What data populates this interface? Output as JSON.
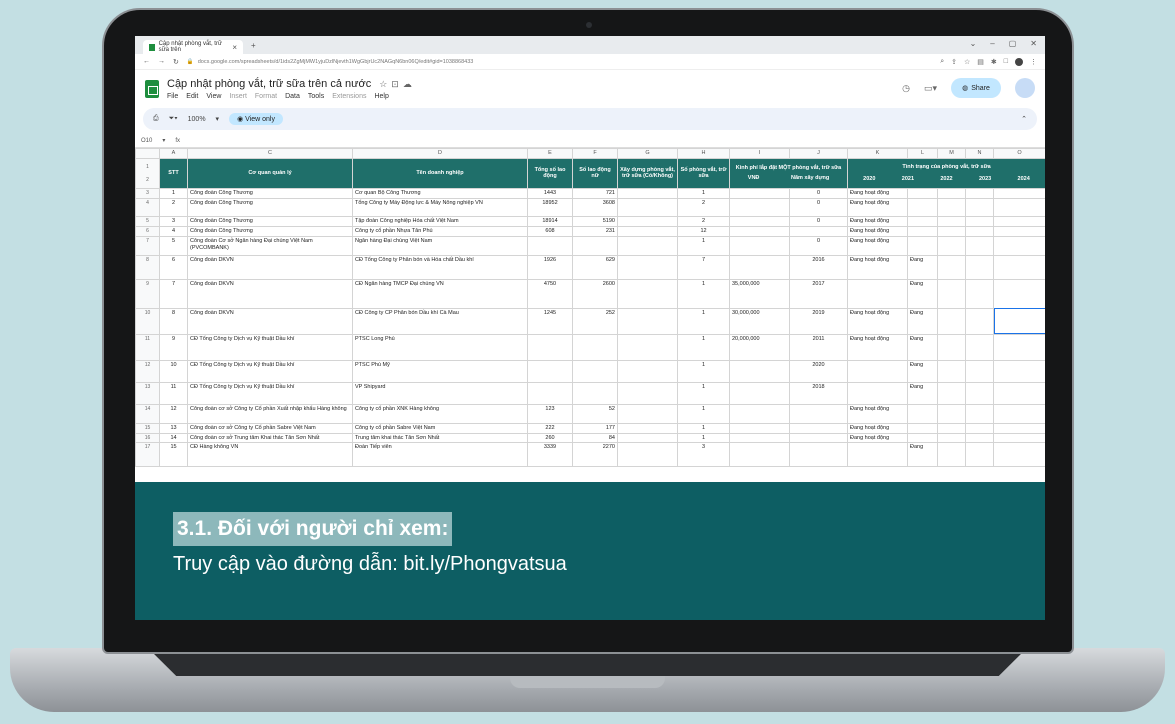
{
  "browser": {
    "tab_title": "Cập nhật phòng vắt, trữ sữa trên",
    "url": "docs.google.com/spreadsheets/d/1ids2ZgMjMW1yjuDzlNjevth1WgGbjrUc2NAGqN6bn06Q/edit#gid=1038868433"
  },
  "doc": {
    "title": "Cập nhật phòng vắt, trữ sữa trên cả nước"
  },
  "menu": {
    "file": "File",
    "edit": "Edit",
    "view": "View",
    "insert": "Insert",
    "format": "Format",
    "data": "Data",
    "tools": "Tools",
    "extensions": "Extensions",
    "help": "Help"
  },
  "header": {
    "share_label": "Share"
  },
  "toolbar": {
    "zoom": "100%",
    "view_only": "View only"
  },
  "formula": {
    "namebox": "O10",
    "fx": "fx"
  },
  "columns": [
    "A",
    "C",
    "D",
    "E",
    "F",
    "G",
    "H",
    "I",
    "J",
    "K",
    "L",
    "M",
    "N",
    "O"
  ],
  "table_header": {
    "stt": "STT",
    "agency": "Cơ quan quản lý",
    "company": "Tên doanh nghiệp",
    "total_workers": "Tổng số lao động",
    "female_workers": "Số lao động nữ",
    "build": "Xây dựng phòng vắt, trữ sữa (Có/Không)",
    "rooms": "Số phòng vắt, trữ sữa",
    "cost": "Kinh phí lắp đặt MỘT phòng vắt, trữ sữa",
    "status": "Tình trạng của phòng vắt, trữ sữa",
    "vnd": "VNĐ",
    "build_year": "Năm xây dựng",
    "y2020": "2020",
    "y2021": "2021",
    "y2022": "2022",
    "y2023": "2023",
    "y2024": "2024"
  },
  "rows": [
    {
      "rn": "3",
      "stt": "1",
      "agency": "Công đoàn Công Thương",
      "company": "Cơ quan Bộ Công Thương",
      "total": "1443",
      "female": "721",
      "build": "",
      "rooms": "1",
      "vnd": "",
      "year": "0",
      "s2020": "Đang hoạt động",
      "s2021": "",
      "rh": 10
    },
    {
      "rn": "4",
      "stt": "2",
      "agency": "Công đoàn Công Thương",
      "company": "Tổng Công ty Máy Động lực & Máy Nông nghiệp VN",
      "total": "18952",
      "female": "3608",
      "build": "",
      "rooms": "2",
      "vnd": "",
      "year": "0",
      "s2020": "Đang hoạt động",
      "s2021": "",
      "rh": 18
    },
    {
      "rn": "5",
      "stt": "3",
      "agency": "Công đoàn Công Thương",
      "company": "Tập đoàn Công nghiệp Hóa chất Việt Nam",
      "total": "18914",
      "female": "5190",
      "build": "",
      "rooms": "2",
      "vnd": "",
      "year": "0",
      "s2020": "Đang hoạt động",
      "s2021": "",
      "rh": 8
    },
    {
      "rn": "6",
      "stt": "4",
      "agency": "Công đoàn Công Thương",
      "company": "Công ty cổ phần Nhựa Tân Phú",
      "total": "608",
      "female": "231",
      "build": "",
      "rooms": "12",
      "vnd": "",
      "year": "",
      "s2020": "Đang hoạt động",
      "s2021": "",
      "rh": 8
    },
    {
      "rn": "7",
      "stt": "5",
      "agency": "Công đoàn Cơ sở Ngân hàng Đại chúng Việt Nam (PVCOMBANK)",
      "company": "Ngân hàng Đại chúng Việt Nam",
      "total": "",
      "female": "",
      "build": "",
      "rooms": "1",
      "vnd": "",
      "year": "0",
      "s2020": "Đang hoạt động",
      "s2021": "",
      "rh": 19
    },
    {
      "rn": "8",
      "stt": "6",
      "agency": "Công đoàn DKVN",
      "company": "CĐ Tổng Công ty Phân bón và Hóa chất Dầu khí",
      "total": "1926",
      "female": "629",
      "build": "",
      "rooms": "7",
      "vnd": "",
      "year": "2016",
      "s2020": "Đang hoạt động",
      "s2021": "Đang",
      "rh": 24
    },
    {
      "rn": "9",
      "stt": "7",
      "agency": "Công đoàn DKVN",
      "company": "CĐ Ngân hàng TMCP Đại chúng VN",
      "total": "4750",
      "female": "2600",
      "build": "",
      "rooms": "1",
      "vnd": "35,000,000",
      "year": "2017",
      "s2020": "",
      "s2021": "Đang",
      "rh": 29
    },
    {
      "rn": "10",
      "stt": "8",
      "agency": "Công đoàn DKVN",
      "company": "CĐ Công ty CP Phân bón Dầu khí Cà Mau",
      "total": "1245",
      "female": "252",
      "build": "",
      "rooms": "1",
      "vnd": "30,000,000",
      "year": "2019",
      "s2020": "Đang hoạt động",
      "s2021": "Đang",
      "rh": 26
    },
    {
      "rn": "11",
      "stt": "9",
      "agency": "CĐ Tổng Công ty Dịch vụ Kỹ thuật Dầu khí",
      "company": "PTSC Long Phú",
      "total": "",
      "female": "",
      "build": "",
      "rooms": "1",
      "vnd": "20,000,000",
      "year": "2011",
      "s2020": "Đang hoạt động",
      "s2021": "Đang",
      "rh": 26
    },
    {
      "rn": "12",
      "stt": "10",
      "agency": "CĐ Tổng Công ty Dịch vụ Kỹ thuật Dầu khí",
      "company": "PTSC Phú Mỹ",
      "total": "",
      "female": "",
      "build": "",
      "rooms": "1",
      "vnd": "",
      "year": "2020",
      "s2020": "",
      "s2021": "Đang",
      "rh": 22
    },
    {
      "rn": "13",
      "stt": "11",
      "agency": "CĐ Tổng Công ty Dịch vụ Kỹ thuật Dầu khí",
      "company": "VP Shipyard",
      "total": "",
      "female": "",
      "build": "",
      "rooms": "1",
      "vnd": "",
      "year": "2018",
      "s2020": "",
      "s2021": "Đang",
      "rh": 22
    },
    {
      "rn": "14",
      "stt": "12",
      "agency": "Công đoàn cơ sở Công ty Cổ phần Xuất nhập khẩu Hàng không",
      "company": "Công ty cổ phần XNK Hàng không",
      "total": "123",
      "female": "52",
      "build": "",
      "rooms": "1",
      "vnd": "",
      "year": "",
      "s2020": "Đang hoạt động",
      "s2021": "",
      "rh": 19
    },
    {
      "rn": "15",
      "stt": "13",
      "agency": "Công đoàn cơ sở Công ty Cổ phần Sabre Việt Nam",
      "company": "Công ty cổ phần Sabre Việt Nam",
      "total": "222",
      "female": "177",
      "build": "",
      "rooms": "1",
      "vnd": "",
      "year": "",
      "s2020": "Đang hoạt động",
      "s2021": "",
      "rh": 8
    },
    {
      "rn": "16",
      "stt": "14",
      "agency": "Công đoàn cơ sở Trung tâm Khai thác Tân Sơn Nhất",
      "company": "Trung tâm khai thác Tân Sơn Nhất",
      "total": "260",
      "female": "84",
      "build": "",
      "rooms": "1",
      "vnd": "",
      "year": "",
      "s2020": "Đang hoạt động",
      "s2021": "",
      "rh": 8
    },
    {
      "rn": "17",
      "stt": "15",
      "agency": "CĐ Hàng không VN",
      "company": "Đoàn Tiếp viên",
      "total": "3339",
      "female": "2270",
      "build": "",
      "rooms": "3",
      "vnd": "",
      "year": "",
      "s2020": "",
      "s2021": "Đang",
      "rh": 24
    }
  ],
  "overlay": {
    "heading": "3.1. Đối với người chỉ xem:",
    "subtext": "Truy cập vào đường dẫn: bit.ly/Phongvatsua"
  },
  "colors": {
    "background": "#c3dfe3",
    "overlay": "#0d5e63",
    "heading_bg": "#8db8bb",
    "header_cells": "#1f6f6a"
  }
}
